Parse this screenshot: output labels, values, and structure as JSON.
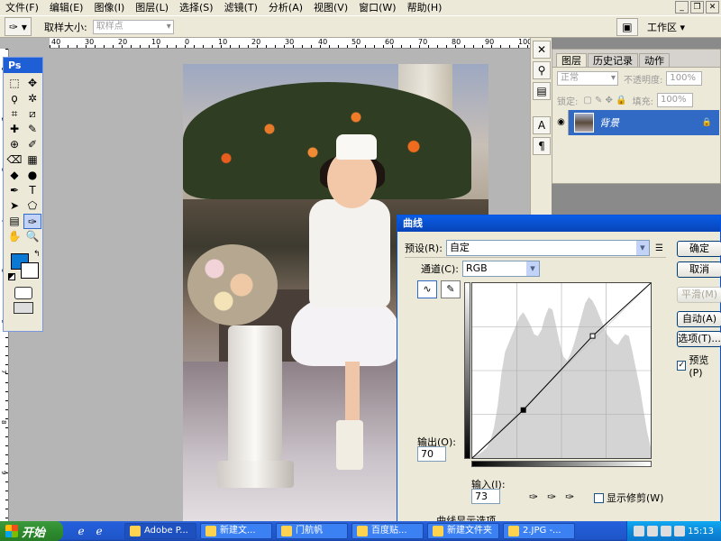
{
  "menu": {
    "items": [
      "文件(F)",
      "编辑(E)",
      "图像(I)",
      "图层(L)",
      "选择(S)",
      "滤镜(T)",
      "分析(A)",
      "视图(V)",
      "窗口(W)",
      "帮助(H)"
    ]
  },
  "options_bar": {
    "sample_size_label": "取样大小:",
    "sample_size_value": "取样点",
    "workspace_label": "工作区 ▾"
  },
  "ruler": {
    "h_ticks": [
      "40",
      "30",
      "20",
      "10",
      "0",
      "10",
      "20",
      "30",
      "40",
      "50",
      "60",
      "70",
      "80",
      "90",
      "100"
    ],
    "v_ticks": [
      "1",
      "2",
      "3",
      "4",
      "5",
      "6",
      "7",
      "8",
      "9"
    ]
  },
  "toolbox": {
    "header": "Ps",
    "tools": [
      "marquee-icon",
      "move-icon",
      "lasso-icon",
      "magic-wand-icon",
      "crop-icon",
      "slice-icon",
      "healing-icon",
      "brush-icon",
      "stamp-icon",
      "history-brush-icon",
      "eraser-icon",
      "gradient-icon",
      "blur-icon",
      "dodge-icon",
      "pen-icon",
      "type-icon",
      "path-select-icon",
      "shape-icon",
      "notes-icon",
      "eyedropper-icon",
      "hand-icon",
      "zoom-icon"
    ],
    "tool_glyphs": [
      "⬚",
      "✥",
      "ϙ",
      "✲",
      "⌗",
      "⧄",
      "✚",
      "✎",
      "⊕",
      "✐",
      "⌫",
      "▦",
      "◆",
      "●",
      "✒",
      "T",
      "➤",
      "⬠",
      "▤",
      "✑",
      "✋",
      "🔍"
    ],
    "selected_tool": "eyedropper-icon",
    "fg_color": "#0a78d5",
    "bg_color": "#ffffff"
  },
  "dock": {
    "icons": [
      "tools-panel-icon",
      "brushes-icon",
      "clone-source-icon",
      "character-icon",
      "paragraph-icon"
    ],
    "glyphs": [
      "✕",
      "⚲",
      "▤",
      "A",
      "¶"
    ]
  },
  "layers_panel": {
    "tabs": [
      "图层",
      "历史记录",
      "动作"
    ],
    "blend_mode": "正常",
    "opacity_label": "不透明度:",
    "opacity_value": "100%",
    "lock_label": "锁定:",
    "fill_label": "填充:",
    "fill_value": "100%",
    "layer_name": "背景"
  },
  "curves_dialog": {
    "title": "曲线",
    "preset_label": "预设(R):",
    "preset_value": "自定",
    "channel_label": "通道(C):",
    "channel_value": "RGB",
    "output_label": "输出(O):",
    "output_value": "70",
    "input_label": "输入(I):",
    "input_value": "73",
    "show_clipping_label": "显示修剪(W)",
    "display_options_label": "曲线显示选项",
    "buttons": {
      "ok": "确定",
      "cancel": "取消",
      "smooth": "平滑(M)",
      "auto": "自动(A)",
      "options": "选项(T)..."
    },
    "preview_label": "预览(P)",
    "preview_checked": true,
    "curve_points": [
      [
        0,
        0
      ],
      [
        73,
        70
      ],
      [
        172,
        178
      ],
      [
        255,
        255
      ]
    ],
    "histogram": [
      2,
      3,
      5,
      8,
      12,
      20,
      35,
      60,
      95,
      120,
      130,
      140,
      150,
      160,
      165,
      158,
      150,
      140,
      138,
      145,
      160,
      170,
      168,
      150,
      130,
      115,
      110,
      118,
      130,
      145,
      160,
      175,
      182,
      178,
      170,
      160,
      150,
      140,
      135,
      130,
      128,
      135,
      140,
      138,
      120,
      100,
      80,
      55,
      30,
      12
    ]
  },
  "taskbar": {
    "start_label": "开始",
    "tasks": [
      "Adobe P...",
      "新建文...",
      "门航帆",
      "百度贴...",
      "新建文件夹",
      "2.JPG -..."
    ],
    "clock": "15:13"
  }
}
